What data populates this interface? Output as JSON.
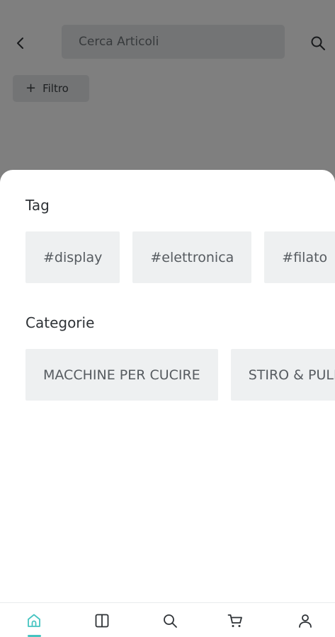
{
  "colors": {
    "accent": "#46c4c1",
    "overlay": "rgba(0,0,0,0.5)",
    "chip_background": "#eef0f1",
    "text": "#2e3236"
  },
  "header": {
    "back_icon": "chevron-left-icon",
    "search_placeholder": "Cerca Articoli",
    "search_icon": "search-icon",
    "filter_icon": "plus-icon",
    "filter_plus": "+",
    "filter_label": "Filtro"
  },
  "sheet": {
    "tag_title": "Tag",
    "tags": [
      "#display",
      "#elettronica",
      "#filato"
    ],
    "categories_title": "Categorie",
    "categories": [
      "MACCHINE PER CUCIRE",
      "STIRO & PULIZIA"
    ]
  },
  "bottom_nav": {
    "active": "home",
    "items": [
      {
        "id": "home",
        "icon": "home-icon"
      },
      {
        "id": "catalog",
        "icon": "book-icon"
      },
      {
        "id": "search",
        "icon": "search-icon"
      },
      {
        "id": "cart",
        "icon": "cart-icon"
      },
      {
        "id": "account",
        "icon": "user-icon"
      }
    ]
  }
}
